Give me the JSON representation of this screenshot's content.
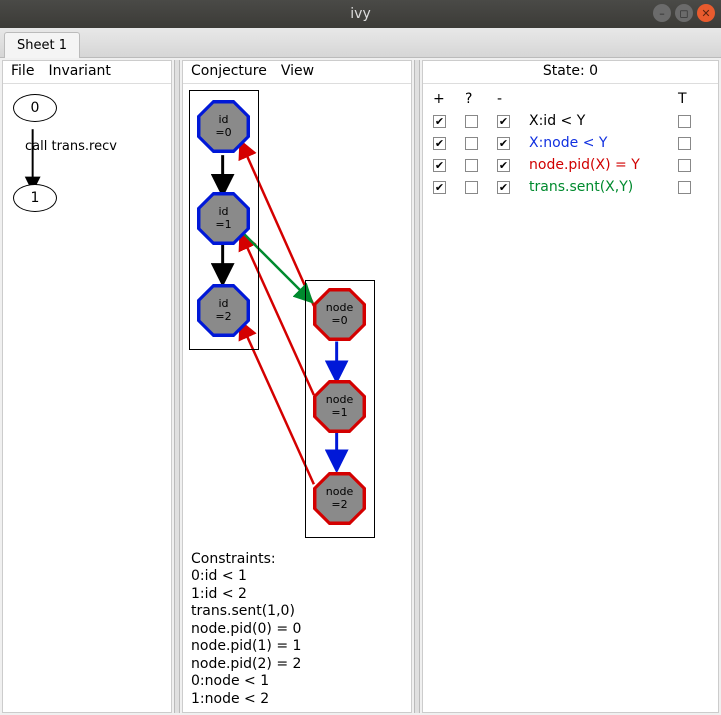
{
  "window": {
    "title": "ivy"
  },
  "tabs": [
    {
      "label": "Sheet 1"
    }
  ],
  "left": {
    "menu": {
      "file": "File",
      "invariant": "Invariant"
    },
    "graph": {
      "nodes": [
        {
          "label": "0"
        },
        {
          "label": "1"
        }
      ],
      "edge_label": "call trans.recv"
    }
  },
  "center": {
    "menu": {
      "conjecture": "Conjecture",
      "view": "View"
    },
    "id_nodes": [
      {
        "label": "id\n=0"
      },
      {
        "label": "id\n=1"
      },
      {
        "label": "id\n=2"
      }
    ],
    "node_nodes": [
      {
        "label": "node\n=0"
      },
      {
        "label": "node\n=1"
      },
      {
        "label": "node\n=2"
      }
    ],
    "constraints_title": "Constraints:",
    "constraints": [
      "0:id < 1",
      "1:id < 2",
      "trans.sent(1,0)",
      "node.pid(0) = 0",
      "node.pid(1) = 1",
      "node.pid(2) = 2",
      "0:node < 1",
      "1:node < 2"
    ]
  },
  "right": {
    "title": "State: 0",
    "columns": {
      "plus": "+",
      "question": "?",
      "minus": "-",
      "t": "T"
    },
    "rows": [
      {
        "plus": true,
        "question": false,
        "minus": true,
        "label": "X:id < Y",
        "t": false,
        "color": "black"
      },
      {
        "plus": true,
        "question": false,
        "minus": true,
        "label": "X:node < Y",
        "t": false,
        "color": "blue"
      },
      {
        "plus": true,
        "question": false,
        "minus": true,
        "label": "node.pid(X) = Y",
        "t": false,
        "color": "red"
      },
      {
        "plus": true,
        "question": false,
        "minus": true,
        "label": "trans.sent(X,Y)",
        "t": false,
        "color": "green"
      }
    ]
  }
}
